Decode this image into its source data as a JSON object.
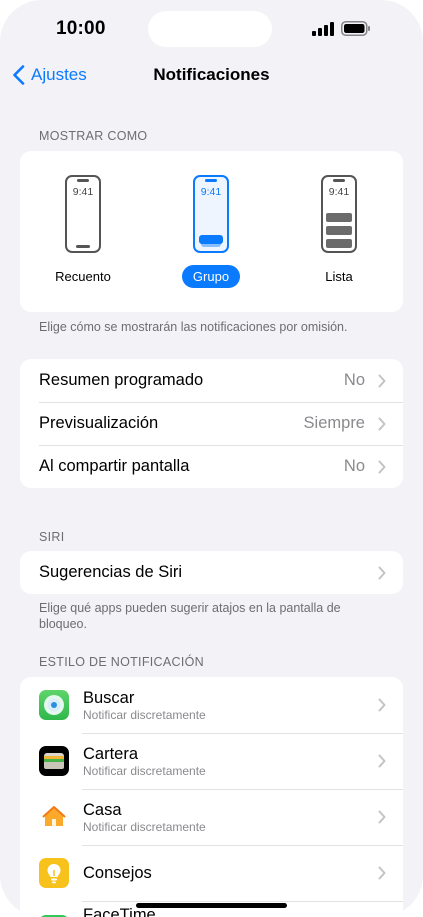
{
  "status": {
    "time": "10:00"
  },
  "nav": {
    "back_label": "Ajustes",
    "title": "Notificaciones"
  },
  "display_as": {
    "header": "MOSTRAR COMO",
    "options": [
      {
        "label": "Recuento",
        "time": "9:41",
        "selected": false
      },
      {
        "label": "Grupo",
        "time": "9:41",
        "selected": true
      },
      {
        "label": "Lista",
        "time": "9:41",
        "selected": false
      }
    ],
    "footer": "Elige cómo se mostrarán las notificaciones por omisión."
  },
  "settings": [
    {
      "label": "Resumen programado",
      "value": "No"
    },
    {
      "label": "Previsualización",
      "value": "Siempre"
    },
    {
      "label": "Al compartir pantalla",
      "value": "No"
    }
  ],
  "siri": {
    "header": "SIRI",
    "row_label": "Sugerencias de Siri",
    "footer": "Elige qué apps pueden sugerir atajos en la pantalla de bloqueo."
  },
  "notification_style": {
    "header": "ESTILO DE NOTIFICACIÓN",
    "apps": [
      {
        "name": "Buscar",
        "subtitle": "Notificar discretamente",
        "icon": "find-my-icon"
      },
      {
        "name": "Cartera",
        "subtitle": "Notificar discretamente",
        "icon": "wallet-icon"
      },
      {
        "name": "Casa",
        "subtitle": "Notificar discretamente",
        "icon": "home-icon"
      },
      {
        "name": "Consejos",
        "subtitle": "",
        "icon": "tips-icon"
      },
      {
        "name": "FaceTime",
        "subtitle": "",
        "icon": "facetime-icon"
      }
    ]
  },
  "colors": {
    "accent": "#0a7aff",
    "background": "#f2f2f7"
  }
}
